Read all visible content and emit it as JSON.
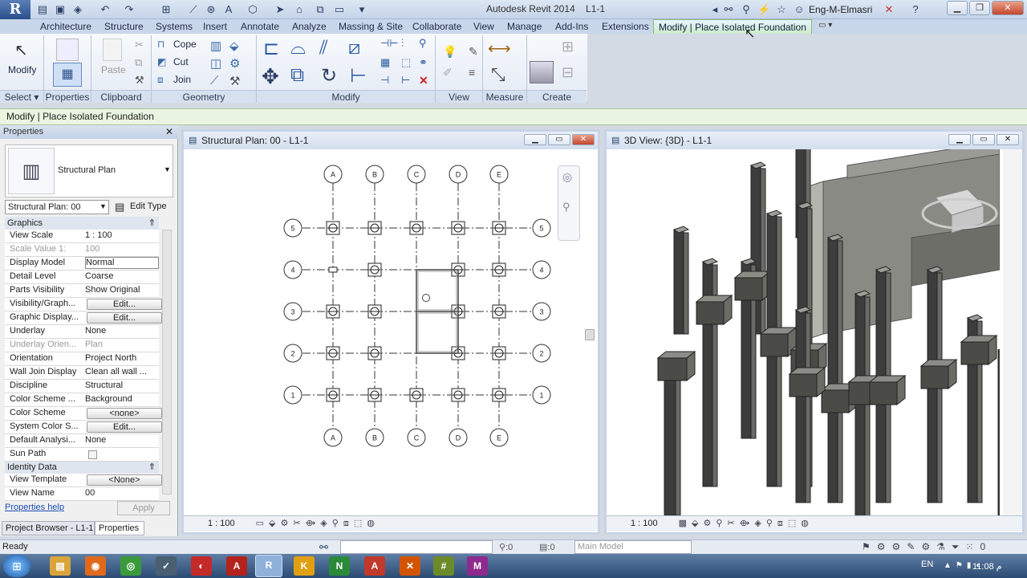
{
  "app": {
    "title": "Autodesk Revit 2014",
    "file": "L1-1",
    "user": "Eng-M-Elmasri",
    "app_button": "R"
  },
  "tabs": [
    "Architecture",
    "Structure",
    "Systems",
    "Insert",
    "Annotate",
    "Analyze",
    "Massing & Site",
    "Collaborate",
    "View",
    "Manage",
    "Add-Ins",
    "Extensions",
    "Modify | Place Isolated Foundation"
  ],
  "ribbon": {
    "modify": "Modify",
    "properties": "Properties",
    "paste": "Paste",
    "cope": "Cope",
    "cut": "Cut",
    "join": "Join",
    "panels": [
      "Select",
      "Properties",
      "Clipboard",
      "Geometry",
      "Modify",
      "View",
      "Measure",
      "Create"
    ]
  },
  "context_bar": "Modify | Place Isolated Foundation",
  "properties": {
    "title": "Properties",
    "type_name": "Structural Plan",
    "selector": "Structural Plan: 00",
    "edit_type": "Edit Type",
    "groups": {
      "graphics": "Graphics",
      "identity": "Identity Data"
    },
    "rows": [
      {
        "label": "View Scale",
        "value": "1 : 100"
      },
      {
        "label": "Scale Value    1:",
        "value": "100",
        "disabled": true
      },
      {
        "label": "Display Model",
        "value": "Normal"
      },
      {
        "label": "Detail Level",
        "value": "Coarse"
      },
      {
        "label": "Parts Visibility",
        "value": "Show Original"
      },
      {
        "label": "Visibility/Graph...",
        "value": "Edit...",
        "button": true
      },
      {
        "label": "Graphic Display...",
        "value": "Edit...",
        "button": true
      },
      {
        "label": "Underlay",
        "value": "None"
      },
      {
        "label": "Underlay Orien...",
        "value": "Plan",
        "disabled": true
      },
      {
        "label": "Orientation",
        "value": "Project North"
      },
      {
        "label": "Wall Join Display",
        "value": "Clean all wall ..."
      },
      {
        "label": "Discipline",
        "value": "Structural"
      },
      {
        "label": "Color Scheme ...",
        "value": "Background"
      },
      {
        "label": "Color Scheme",
        "value": "<none>",
        "button": true
      },
      {
        "label": "System Color S...",
        "value": "Edit...",
        "button": true
      },
      {
        "label": "Default Analysi...",
        "value": "None"
      },
      {
        "label": "Sun Path",
        "value": ""
      }
    ],
    "identity_rows": [
      {
        "label": "View Template",
        "value": "<None>",
        "button": true
      },
      {
        "label": "View Name",
        "value": "00"
      }
    ],
    "help": "Properties help",
    "apply": "Apply",
    "bottom_tabs": [
      "Project Browser - L1-1",
      "Properties"
    ]
  },
  "plan_view": {
    "title": "Structural Plan: 00 - L1-1",
    "scale": "1 : 100",
    "grid_columns": [
      "A",
      "B",
      "C",
      "D",
      "E"
    ],
    "grid_rows": [
      "5",
      "4",
      "3",
      "2",
      "1"
    ]
  },
  "view3d": {
    "title": "3D View: {3D} - L1-1",
    "scale": "1 : 100"
  },
  "status": {
    "text": "Ready",
    "model": "Main Model",
    "selection_count": ":0",
    "filter_count": ":0"
  },
  "taskbar": {
    "lang": "EN",
    "time": "11:08 م"
  },
  "colors": {
    "accent": "#2c4f8c",
    "context": "#eaf5e1"
  }
}
